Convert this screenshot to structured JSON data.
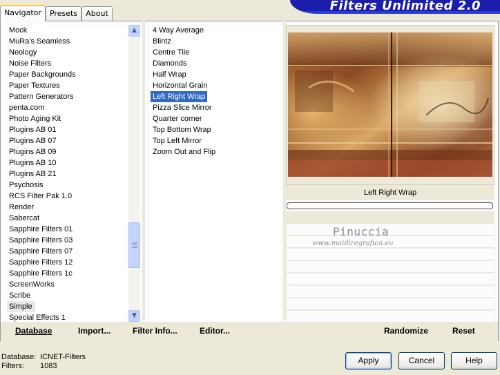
{
  "tabs": [
    {
      "label": "Navigator",
      "active": true
    },
    {
      "label": "Presets",
      "active": false
    },
    {
      "label": "About",
      "active": false
    }
  ],
  "banner_title": "Filters Unlimited 2.0",
  "categories": [
    "Mock",
    "MuRa's Seamless",
    "Neology",
    "Noise Filters",
    "Paper Backgrounds",
    "Paper Textures",
    "Pattern Generators",
    "penta.com",
    "Photo Aging Kit",
    "Plugins AB 01",
    "Plugins AB 07",
    "Plugins AB 09",
    "Plugins AB 10",
    "Plugins AB 21",
    "Psychosis",
    "RCS Filter Pak 1.0",
    "Render",
    "Sabercat",
    "Sapphire Filters 01",
    "Sapphire Filters 03",
    "Sapphire Filters 07",
    "Sapphire Filters 12",
    "Sapphire Filters 1c",
    "ScreenWorks",
    "Scribe",
    "Simple",
    "Special Effects 1"
  ],
  "selected_category": "Simple",
  "filters": [
    "4 Way Average",
    "Blintz",
    "Centre Tile",
    "Diamonds",
    "Half Wrap",
    "Horizontal Grain",
    "Left Right Wrap",
    "Pizza Slice Mirror",
    "Quarter corner",
    "Top Bottom Wrap",
    "Top Left Mirror",
    "Zoom Out and Flip"
  ],
  "selected_filter": "Left Right Wrap",
  "preview": {
    "filter_label": "Left Right Wrap",
    "progress": 0,
    "watermark_name": "Pinuccia",
    "watermark_url": "www.maidiregrafica.eu"
  },
  "actions": {
    "database": "Database",
    "import": "Import...",
    "filter_info": "Filter Info...",
    "editor": "Editor...",
    "randomize": "Randomize",
    "reset": "Reset"
  },
  "footer": {
    "database_label": "Database:",
    "database_value": "ICNET-Filters",
    "filters_label": "Filters:",
    "filters_value": "1083"
  },
  "buttons": {
    "apply": "Apply",
    "cancel": "Cancel",
    "help": "Help"
  },
  "colors": {
    "banner": "#1b1dab",
    "selection": "#316ac5",
    "window_bg": "#ece9d8"
  }
}
